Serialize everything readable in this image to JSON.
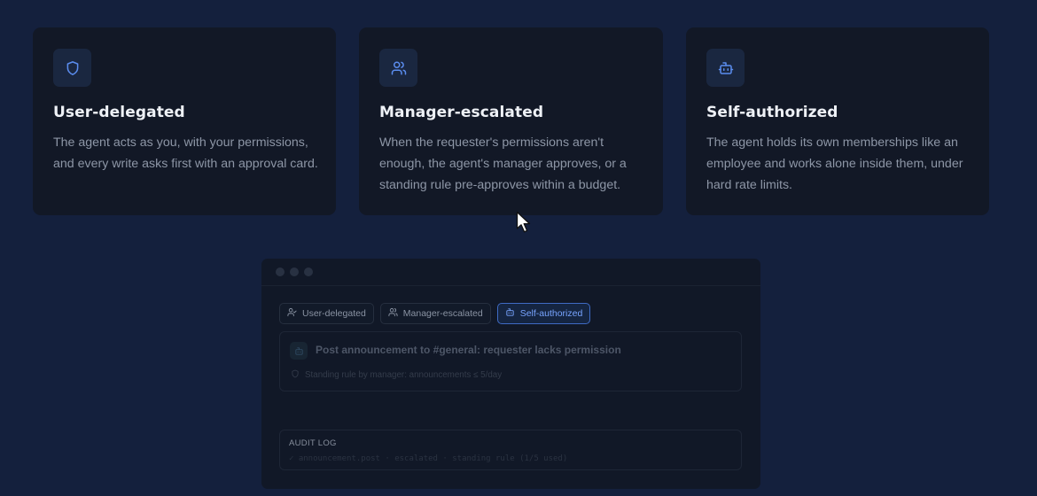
{
  "cards": [
    {
      "icon": "shield-icon",
      "title": "User-delegated",
      "description": "The agent acts as you, with your permissions, and every write asks first with an approval card."
    },
    {
      "icon": "users-icon",
      "title": "Manager-escalated",
      "description": "When the requester's permissions aren't enough, the agent's manager approves, or a standing rule pre-approves within a budget."
    },
    {
      "icon": "bot-icon",
      "title": "Self-authorized",
      "description": "The agent holds its own memberships like an employee and works alone inside them, under hard rate limits."
    }
  ],
  "demo": {
    "tabs": [
      {
        "label": "User-delegated",
        "icon": "user-check-icon"
      },
      {
        "label": "Manager-escalated",
        "icon": "users-icon"
      },
      {
        "label": "Self-authorized",
        "icon": "bot-icon"
      }
    ],
    "active_tab": "Self-authorized",
    "request": {
      "title": "Post announcement to #general: requester lacks permission",
      "subtitle": "Standing rule by manager: announcements ≤ 5/day"
    },
    "audit": {
      "label": "AUDIT LOG",
      "entry": "✓ announcement.post · escalated · standing rule (1/5 used)"
    }
  },
  "colors": {
    "background": "#14203d",
    "card": "#121826",
    "accent": "#5b8def"
  }
}
